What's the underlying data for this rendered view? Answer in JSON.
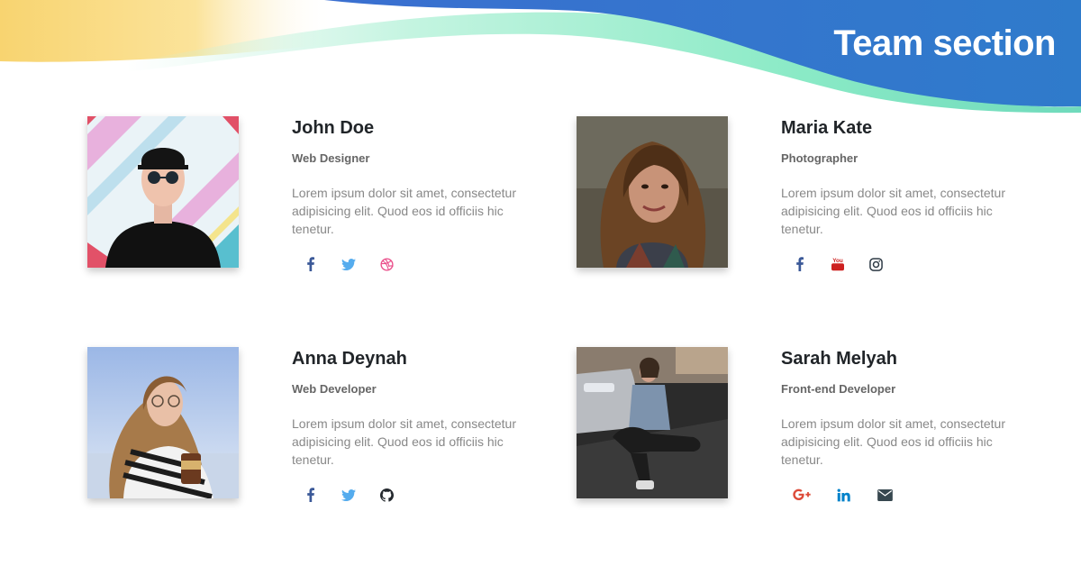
{
  "header": {
    "title": "Team section",
    "colors": {
      "blue": "#2f73c9",
      "mint": "#7ee8c0",
      "yellow": "#f9d36a"
    }
  },
  "members": [
    {
      "name": "John Doe",
      "role": "Web Designer",
      "description": "Lorem ipsum dolor sit amet, consectetur adipisicing elit. Quod eos id officiis hic tenetur.",
      "socials": [
        "facebook-icon",
        "twitter-icon",
        "dribbble-icon"
      ]
    },
    {
      "name": "Maria Kate",
      "role": "Photographer",
      "description": "Lorem ipsum dolor sit amet, consectetur adipisicing elit. Quod eos id officiis hic tenetur.",
      "socials": [
        "facebook-icon",
        "youtube-icon",
        "instagram-icon"
      ]
    },
    {
      "name": "Anna Deynah",
      "role": "Web Developer",
      "description": "Lorem ipsum dolor sit amet, consectetur adipisicing elit. Quod eos id officiis hic tenetur.",
      "socials": [
        "facebook-icon",
        "twitter-icon",
        "github-icon"
      ]
    },
    {
      "name": "Sarah Melyah",
      "role": "Front-end Developer",
      "description": "Lorem ipsum dolor sit amet, consectetur adipisicing elit. Quod eos id officiis hic tenetur.",
      "socials": [
        "google-plus-icon",
        "linkedin-icon",
        "envelope-icon"
      ]
    }
  ],
  "icon_text": {
    "youtube_label": "You"
  }
}
